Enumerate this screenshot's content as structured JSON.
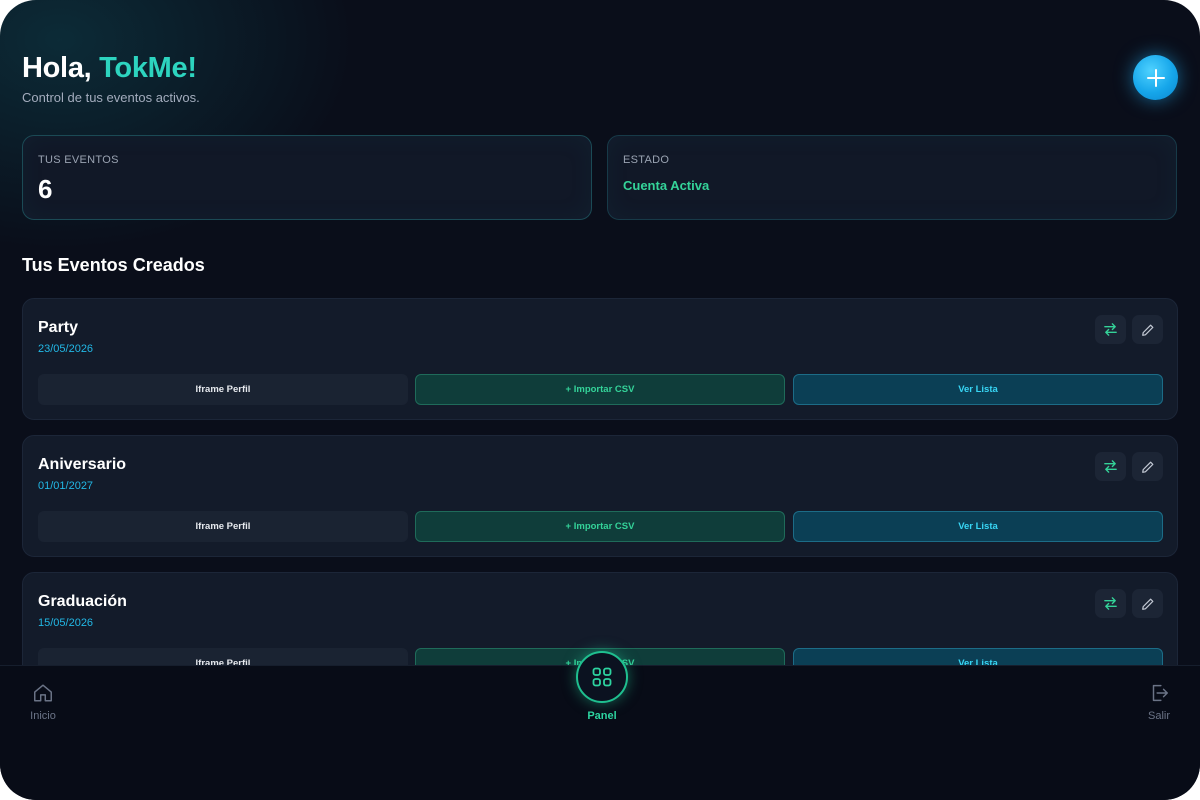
{
  "header": {
    "greeting": "Hola,",
    "user_name": "TokMe!",
    "subtitle": "Control de tus eventos activos."
  },
  "stats": {
    "events_label": "TUS EVENTOS",
    "events_count": "6",
    "status_label": "ESTADO",
    "status_value": "Cuenta Activa"
  },
  "section_title": "Tus Eventos Creados",
  "events": [
    {
      "name": "Party",
      "date": "23/05/2026",
      "btn_iframe": "Iframe Perfil",
      "btn_import": "+ Importar CSV",
      "btn_list": "Ver Lista"
    },
    {
      "name": "Aniversario",
      "date": "01/01/2027",
      "btn_iframe": "Iframe Perfil",
      "btn_import": "+ Importar CSV",
      "btn_list": "Ver Lista"
    },
    {
      "name": "Graduación",
      "date": "15/05/2026",
      "btn_iframe": "Iframe Perfil",
      "btn_import": "+ Importar CSV",
      "btn_list": "Ver Lista"
    }
  ],
  "nav": {
    "home": "Inicio",
    "panel": "Panel",
    "exit": "Salir"
  },
  "icons": {
    "fab": "plus-icon",
    "swap": "swap-arrows-icon",
    "edit": "pencil-icon",
    "home": "home-icon",
    "panel": "grid-icon",
    "exit": "logout-icon"
  },
  "colors": {
    "background": "#0a0e1a",
    "accent_teal": "#2dd4bf",
    "accent_green": "#34d399",
    "accent_blue": "#22b8e6",
    "fab": "#16a6ea"
  }
}
